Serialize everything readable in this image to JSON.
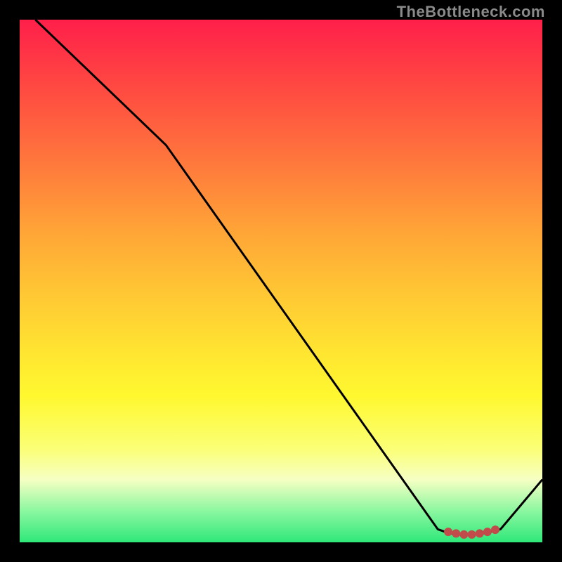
{
  "watermark": "TheBottleneck.com",
  "chart_data": {
    "type": "line",
    "title": "",
    "xlabel": "",
    "ylabel": "",
    "xlim": [
      0,
      100
    ],
    "ylim": [
      0,
      100
    ],
    "series": [
      {
        "name": "bottleneck-curve",
        "x": [
          3,
          28,
          80,
          82,
          84,
          86,
          88,
          90,
          92,
          100
        ],
        "values": [
          100,
          76,
          2.5,
          1.8,
          1.5,
          1.5,
          1.6,
          2.0,
          2.5,
          12
        ]
      }
    ],
    "markers": {
      "name": "optimal-zone",
      "x": [
        82,
        83.5,
        85,
        86.5,
        88,
        89.5,
        91
      ],
      "values": [
        2.0,
        1.7,
        1.5,
        1.5,
        1.7,
        2.0,
        2.4
      ],
      "size": 6,
      "color": "#c24a4a"
    },
    "colors": {
      "line": "#000000",
      "marker": "#c24a4a"
    }
  }
}
